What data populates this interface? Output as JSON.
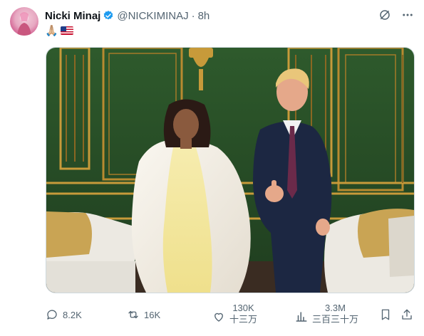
{
  "author": {
    "name": "Nicki Minaj",
    "handle": "@NICKIMINAJ",
    "separator": "·",
    "time": "8h"
  },
  "tweet": {
    "emoji": "🙏🏼",
    "flag_icon": "us-flag-icon"
  },
  "media": {
    "description_icon": "photo"
  },
  "metrics": {
    "replies": "8.2K",
    "reposts": "16K",
    "likes": "130K",
    "likes_cn": "十三万",
    "views": "3.3M",
    "views_cn": "三百三十万"
  },
  "colors": {
    "verified": "#1d9bf0",
    "muted_text": "#536471",
    "wall_green": "#2f5a2f",
    "gold": "#c79a3a"
  }
}
